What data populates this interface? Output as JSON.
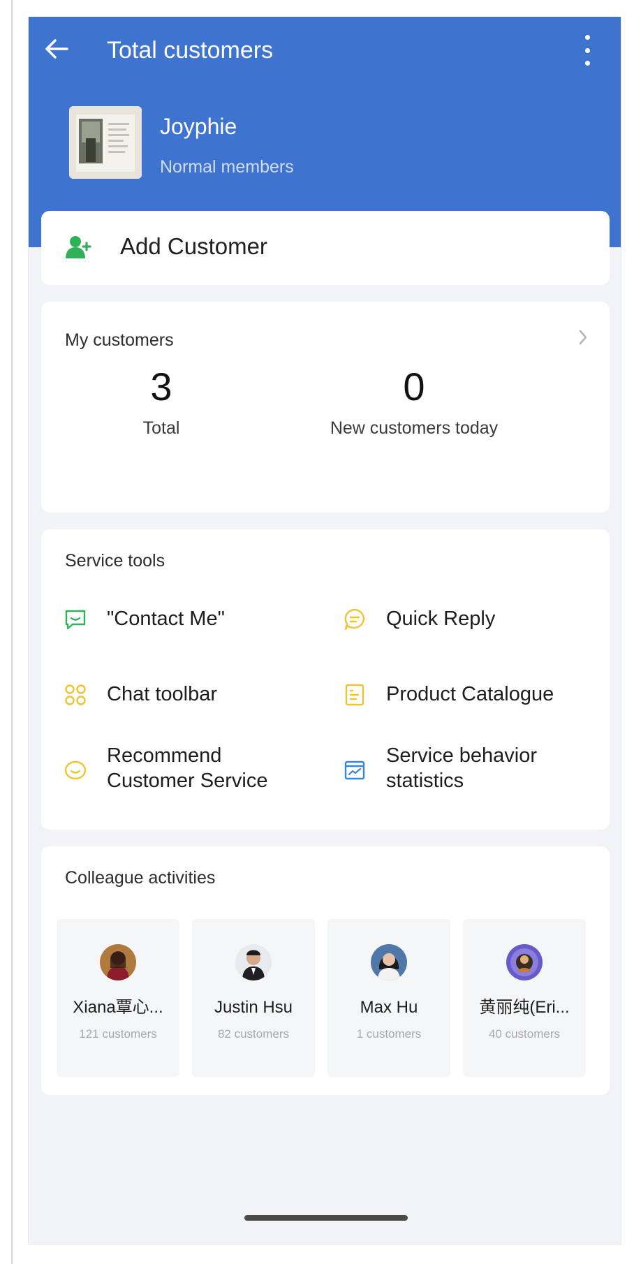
{
  "header": {
    "title": "Total customers",
    "back_icon": "arrow-left-icon",
    "menu_icon": "more-vertical-icon",
    "user": {
      "name": "Joyphie",
      "role": "Normal members"
    }
  },
  "add_customer": {
    "label": "Add Customer",
    "icon": "add-user-icon"
  },
  "my_customers": {
    "title": "My customers",
    "stats": [
      {
        "value": "3",
        "label": "Total"
      },
      {
        "value": "0",
        "label": "New customers today"
      }
    ]
  },
  "service_tools": {
    "title": "Service tools",
    "items": [
      {
        "label": "\"Contact Me\"",
        "icon": "contact-chat-icon"
      },
      {
        "label": "Quick Reply",
        "icon": "quick-reply-icon"
      },
      {
        "label": "Chat toolbar",
        "icon": "toolbar-icon"
      },
      {
        "label": "Product Catalogue",
        "icon": "catalogue-icon"
      },
      {
        "label": "Recommend Customer Service",
        "line1": "Recommend",
        "line2": "Customer Service",
        "icon": "recommend-service-icon"
      },
      {
        "label": "Service behavior statistics",
        "line1": "Service behavior",
        "line2": "statistics",
        "icon": "statistics-icon"
      }
    ]
  },
  "colleague_activities": {
    "title": "Colleague activities",
    "people": [
      {
        "name": "Xiana覃心...",
        "customers": "121 customers"
      },
      {
        "name": "Justin Hsu",
        "customers": "82 customers"
      },
      {
        "name": "Max Hu",
        "customers": "1 customers"
      },
      {
        "name": "黄丽纯(Eri...",
        "customers": "40 customers"
      }
    ]
  },
  "colors": {
    "header_blue": "#3f73d0",
    "green": "#2fb157",
    "yellow": "#f0c332",
    "blue_icon": "#3a86d6"
  }
}
